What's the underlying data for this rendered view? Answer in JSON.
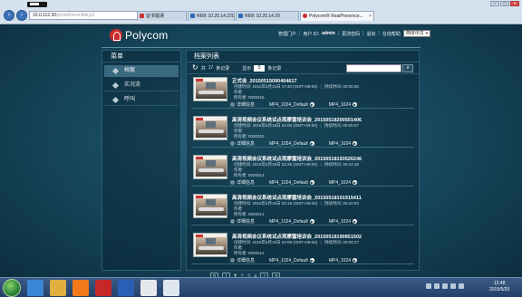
{
  "browser": {
    "address": {
      "host": "10.0.112.30",
      "path": "/portal/recordlist.jsf"
    },
    "tabs": [
      {
        "label": "证书错误",
        "icon": "error-icon"
      },
      {
        "label": "RMX 10.20.14.220",
        "icon": "rmx-icon"
      },
      {
        "label": "RMX 10.20.14.20",
        "icon": "rmx-icon"
      },
      {
        "label": "Polycom® RealPresence...",
        "icon": "polycom-tab-icon"
      }
    ]
  },
  "header": {
    "logo_text": "Polycom",
    "links": [
      "管理门户",
      "更改密码",
      "退出",
      "在线帮助"
    ],
    "account_label": "用户 ID:",
    "account_id": "admin",
    "language": "简体中文"
  },
  "sidebar": {
    "title": "菜单",
    "items": [
      {
        "label": "档案",
        "active": true
      },
      {
        "label": "实况流",
        "active": false
      },
      {
        "label": "呼叫",
        "active": false
      }
    ]
  },
  "main": {
    "title": "档案列表",
    "total_prefix": "共",
    "total_count": "17",
    "total_suffix": "条记录",
    "per_page_label": "显示",
    "per_page_value": "5",
    "per_page_suffix": "条记录",
    "created_label": "创建时间:",
    "duration_label": "持续时间:",
    "author_label": "作者:",
    "owner_label": "所有者:",
    "detail_label": "详细信息",
    "records": [
      {
        "name": "正式会_20150515090404617",
        "created": "2015年5月15日 17:40 (GMT+08:00)",
        "duration": "00:00:06",
        "author": "",
        "id": "0000016",
        "formats": [
          "MP4_1024_Default",
          "MP4_1024"
        ]
      },
      {
        "name": "高清视频会议系统试点观摩暨培训会_20150518200501406",
        "created": "2015年5月18日 04:05 (GMT+08:00)",
        "duration": "00:00:07",
        "author": "",
        "id": "0000015",
        "formats": [
          "MP4_1024_Default",
          "MP4_1024"
        ]
      },
      {
        "name": "高清视频会议系统试点观摩暨培训会_20150518193526246",
        "created": "2015年5月18日 03:35 (GMT+08:00)",
        "duration": "00:14:48",
        "author": "",
        "id": "0000014",
        "formats": [
          "MP4_1024_Default",
          "MP4_1024"
        ]
      },
      {
        "name": "高清视频会议系统试点观摩暨培训会_20150518191915411",
        "created": "2015年5月18日 03:19 (GMT+08:00)",
        "duration": "00:10:53",
        "author": "",
        "id": "0000013",
        "formats": [
          "MP4_1024_Default",
          "MP4_1024"
        ]
      },
      {
        "name": "高清视频会议系统试点观摩暨培训会_20150518190851502",
        "created": "2015年5月18日 03:08 (GMT+08:00)",
        "duration": "00:08:27",
        "author": "",
        "id": "0000012",
        "formats": [
          "MP4_1024_Default",
          "MP4_1024"
        ]
      }
    ]
  },
  "pagination": {
    "current": "1",
    "pages": [
      "2",
      "3",
      "4"
    ]
  },
  "taskbar": {
    "apps": [
      {
        "name": "ie-app-icon",
        "color": "#3a86d6"
      },
      {
        "name": "folder-app-icon",
        "color": "#e0b040"
      },
      {
        "name": "media-player-app-icon",
        "color": "#f07a1a"
      },
      {
        "name": "pdf-app-icon",
        "color": "#c62828"
      },
      {
        "name": "word-app-icon",
        "color": "#2b5fb5"
      },
      {
        "name": "outlook-app-icon",
        "color": "#e5e9ef"
      },
      {
        "name": "sync-app-icon",
        "color": "#dfe6ef"
      }
    ],
    "time": "12:48",
    "date": "2015/5/25"
  }
}
